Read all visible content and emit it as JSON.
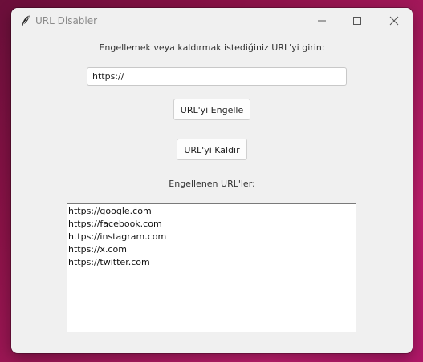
{
  "window": {
    "title": "URL Disabler",
    "icon": "feather-icon",
    "controls": {
      "minimize": "minimize-icon",
      "maximize": "maximize-icon",
      "close": "close-icon"
    }
  },
  "form": {
    "prompt_label": "Engellemek veya kaldırmak istediğiniz URL'yi girin:",
    "url_value": "https://",
    "block_button_label": "URL'yi Engelle",
    "remove_button_label": "URL'yi Kaldır"
  },
  "blocked": {
    "label": "Engellenen URL'ler:",
    "items": [
      "https://google.com",
      "https://facebook.com",
      "https://instagram.com",
      "https://x.com",
      "https://twitter.com"
    ]
  },
  "colors": {
    "background_gradient": [
      "#6b0f3a",
      "#c01f6e"
    ],
    "window_bg": "#f0f0f0"
  }
}
